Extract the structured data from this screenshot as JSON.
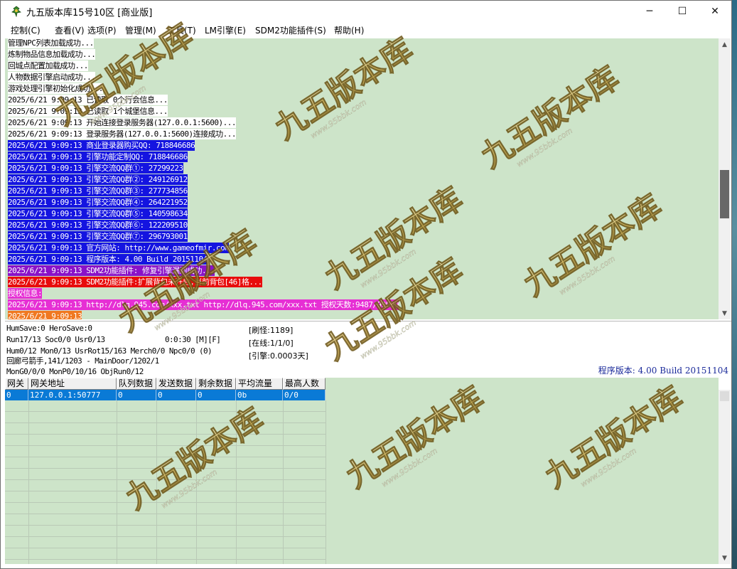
{
  "window": {
    "title": "九五版本库15号10区 [商业版]",
    "controls": {
      "minimize": "─",
      "maximize": "☐",
      "close": "✕"
    }
  },
  "menu": [
    "控制(C)",
    "查看(V)",
    "选项(P)",
    "管理(M)",
    "工具(T)",
    "LM引擎(E)",
    "SDM2功能插件(S)",
    "帮助(H)"
  ],
  "log_lines": [
    {
      "text": "管理NPC列表加载成功...",
      "bg": "#ffffff",
      "color": "#000000"
    },
    {
      "text": "炼制物品信息加载成功...",
      "bg": "#ffffff",
      "color": "#000000"
    },
    {
      "text": "回城点配置加载成功...",
      "bg": "#ffffff",
      "color": "#000000"
    },
    {
      "text": "人物数据引擎启动成功...",
      "bg": "#ffffff",
      "color": "#000000"
    },
    {
      "text": "游戏处理引擎初始化成功...",
      "bg": "#ffffff",
      "color": "#000000"
    },
    {
      "text": "2025/6/21 9:09:13 已读取 0个行会信息...",
      "bg": "#ffffff",
      "color": "#000000"
    },
    {
      "text": "2025/6/21 9:09:13 已读取 1个城堡信息...",
      "bg": "#ffffff",
      "color": "#000000"
    },
    {
      "text": "2025/6/21 9:09:13 开始连接登录服务器(127.0.0.1:5600)...",
      "bg": "#ffffff",
      "color": "#000000"
    },
    {
      "text": "2025/6/21 9:09:13 登录服务器(127.0.0.1:5600)连接成功...",
      "bg": "#ffffff",
      "color": "#000000"
    },
    {
      "text": "2025/6/21 9:09:13 商业登录器购买QQ: 718846686",
      "bg": "#1414e0",
      "color": "#ffffff"
    },
    {
      "text": "2025/6/21 9:09:13 引擎功能定制QQ: 718846686",
      "bg": "#1414e0",
      "color": "#ffffff"
    },
    {
      "text": "2025/6/21 9:09:13 引擎交流QQ群①: 27299223",
      "bg": "#1414e0",
      "color": "#ffffff"
    },
    {
      "text": "2025/6/21 9:09:13 引擎交流QQ群②: 249126912",
      "bg": "#1414e0",
      "color": "#ffffff"
    },
    {
      "text": "2025/6/21 9:09:13 引擎交流QQ群③: 277734856",
      "bg": "#1414e0",
      "color": "#ffffff"
    },
    {
      "text": "2025/6/21 9:09:13 引擎交流QQ群④: 264221952",
      "bg": "#1414e0",
      "color": "#ffffff"
    },
    {
      "text": "2025/6/21 9:09:13 引擎交流QQ群⑤: 140598634",
      "bg": "#1414e0",
      "color": "#ffffff"
    },
    {
      "text": "2025/6/21 9:09:13 引擎交流QQ群⑥: 122209510",
      "bg": "#1414e0",
      "color": "#ffffff"
    },
    {
      "text": "2025/6/21 9:09:13 引擎交流QQ群⑦: 296793001",
      "bg": "#1414e0",
      "color": "#ffffff"
    },
    {
      "text": "2025/6/21 9:09:13 官方网站: http://www.gameofmir.com",
      "bg": "#1414e0",
      "color": "#ffffff"
    },
    {
      "text": "2025/6/21 9:09:13 程序版本: 4.00 Build 20151104",
      "bg": "#1414e0",
      "color": "#ffffff"
    },
    {
      "text": "2025/6/21 9:09:13 SDM2功能插件: 修复引擎漏洞成功...",
      "bg": "#8a12c8",
      "color": "#ffffff"
    },
    {
      "text": "2025/6/21 9:09:13 SDM2功能插件:扩展背包未开启,当前背包[46]格...",
      "bg": "#e80c0c",
      "color": "#ffffff"
    },
    {
      "text": "授权信息:",
      "bg": "#e62fd4",
      "color": "#ffffff"
    },
    {
      "text": "2025/6/21 9:09:13 http://dlq.945.com/xxx.txt http://dlq.945.com/xxx.txt 授权天数:9487/99999",
      "bg": "#e62fd4",
      "color": "#ffffff"
    },
    {
      "text": "2025/6/21 9:09:13 ",
      "bg": "#f07820",
      "color": "#ffffff"
    }
  ],
  "status": {
    "line1": "HumSave:0 HeroSave:0",
    "line2": "Run17/13 Soc0/0 Usr0/13",
    "line2_time": "0:0:30 [M][F]",
    "line3": "Hum0/12 Mon0/13 UsrRot15/163 Merch0/0 Npc0/0 (0)",
    "line4": "回廊弓箭手,141/1203 - MainDoor/1202/1",
    "line5": "MonG0/0/0 MonP0/10/16 ObjRun0/12",
    "refresh_monsters": "[刷怪:1189]",
    "online": "[在线:1/1/0]",
    "engine": "[引擎:0.0003天]",
    "version": "程序版本: 4.00 Build 20151104"
  },
  "gate_table": {
    "headers": [
      "网关",
      "网关地址",
      "队列数据",
      "发送数据",
      "剩余数据",
      "平均流量",
      "最高人数"
    ],
    "rows": [
      [
        "0",
        "127.0.0.1:50777",
        "0",
        "0",
        "0",
        "0b",
        "0/0"
      ]
    ]
  },
  "watermark": {
    "text": "九五版本库",
    "url": "www.95bbk.com"
  },
  "colors": {
    "log_background": "#cde4c9",
    "selected_row": "#0a7ad6",
    "version_text": "#1a2a9a"
  }
}
